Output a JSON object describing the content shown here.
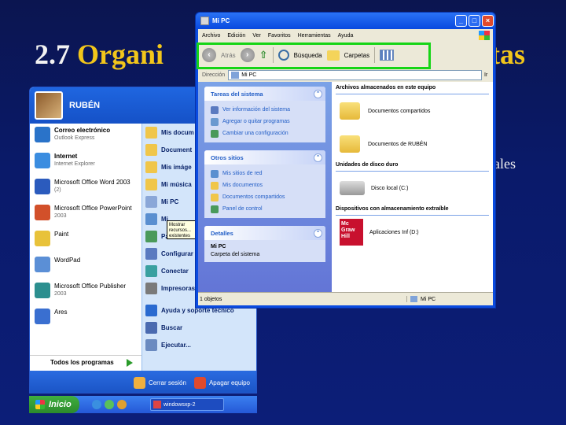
{
  "slide": {
    "title_number": "2.7",
    "title_word": "Organi",
    "title_tail": "tas",
    "side_text": "rales"
  },
  "start_menu": {
    "user": "RUBÉN",
    "left_items": [
      {
        "title": "Correo electrónico",
        "subtitle": "Outlook Express",
        "bold": true,
        "icon": "mail-icon",
        "color": "#2a73c9"
      },
      {
        "title": "Internet",
        "subtitle": "Internet Explorer",
        "bold": true,
        "icon": "internet-explorer-icon",
        "color": "#3b8de0"
      },
      {
        "title": "Microsoft Office Word 2003",
        "subtitle": "(2)",
        "bold": false,
        "icon": "word-icon",
        "color": "#2b5bbd"
      },
      {
        "title": "Microsoft Office PowerPoint",
        "subtitle": "2003",
        "bold": false,
        "icon": "powerpoint-icon",
        "color": "#d2502a"
      },
      {
        "title": "Paint",
        "subtitle": "",
        "bold": false,
        "icon": "paint-icon",
        "color": "#e8c23a"
      },
      {
        "title": "WordPad",
        "subtitle": "",
        "bold": false,
        "icon": "wordpad-icon",
        "color": "#5b8fd6"
      },
      {
        "title": "Microsoft Office Publisher",
        "subtitle": "2003",
        "bold": false,
        "icon": "publisher-icon",
        "color": "#2c8f8f"
      },
      {
        "title": "Ares",
        "subtitle": "",
        "bold": false,
        "icon": "ares-icon",
        "color": "#3a6fd0"
      }
    ],
    "all_programs": "Todos los programas",
    "right_items": [
      {
        "label": "Mis docum",
        "icon": "my-documents-icon",
        "color": "#f0c64a"
      },
      {
        "label": "Document",
        "icon": "recent-documents-icon",
        "color": "#f0c64a"
      },
      {
        "label": "Mis imáge",
        "icon": "my-pictures-icon",
        "color": "#f0c64a"
      },
      {
        "label": "Mi música",
        "icon": "my-music-icon",
        "color": "#f0c64a"
      },
      {
        "label": "Mi PC",
        "icon": "my-computer-icon",
        "color": "#8aa7d8"
      },
      {
        "label": "Mi",
        "icon": "my-network-icon",
        "color": "#5a8fd0"
      },
      {
        "label": "Panel de co",
        "icon": "control-panel-icon",
        "color": "#4a9a5a"
      },
      {
        "label": "Configurar",
        "icon": "set-program-access-icon",
        "color": "#5a7ac0"
      },
      {
        "label": "Conectar",
        "icon": "connect-to-icon",
        "color": "#3aa0a0"
      },
      {
        "label": "Impresoras",
        "icon": "printers-icon",
        "color": "#7a7a7a"
      },
      {
        "label": "Ayuda y soporte técnico",
        "icon": "help-icon",
        "color": "#2a6ad0"
      },
      {
        "label": "Buscar",
        "icon": "search-icon",
        "color": "#4a6ab0"
      },
      {
        "label": "Ejecutar...",
        "icon": "run-icon",
        "color": "#6a8ac0"
      }
    ],
    "tooltip": "Mostrar recursos... existentes",
    "logoff": "Cerrar sesión",
    "shutdown": "Apagar equipo"
  },
  "taskbar": {
    "start": "Inicio",
    "task_label": "windowsxp-2"
  },
  "explorer": {
    "title": "Mi PC",
    "menu": [
      "Archivo",
      "Edición",
      "Ver",
      "Favoritos",
      "Herramientas",
      "Ayuda"
    ],
    "toolbar": {
      "back": "Atrás",
      "search": "Búsqueda",
      "folders": "Carpetas"
    },
    "address_label": "Dirección",
    "address_value": "Mi PC",
    "go": "Ir",
    "panels": {
      "system_tasks": {
        "title": "Tareas del sistema",
        "items": [
          {
            "label": "Ver información del sistema",
            "icon": "system-info-icon",
            "color": "#5a7ac0"
          },
          {
            "label": "Agregar o quitar programas",
            "icon": "add-remove-programs-icon",
            "color": "#6a9ad0"
          },
          {
            "label": "Cambiar una configuración",
            "icon": "change-setting-icon",
            "color": "#4a9a5a"
          }
        ]
      },
      "other_places": {
        "title": "Otros sitios",
        "items": [
          {
            "label": "Mis sitios de red",
            "icon": "network-places-icon",
            "color": "#5a8fd0"
          },
          {
            "label": "Mis documentos",
            "icon": "my-documents-icon",
            "color": "#f0c64a"
          },
          {
            "label": "Documentos compartidos",
            "icon": "shared-documents-icon",
            "color": "#f0c64a"
          },
          {
            "label": "Panel de control",
            "icon": "control-panel-icon",
            "color": "#4a9a5a"
          }
        ]
      },
      "details": {
        "title": "Detalles",
        "name": "Mi PC",
        "desc": "Carpeta del sistema"
      }
    },
    "content": {
      "stored_header": "Archivos almacenados en este equipo",
      "stored": [
        "Documentos compartidos",
        "Documentos de RUBÉN"
      ],
      "hdd_header": "Unidades de disco duro",
      "hdd": [
        "Disco local (C:)"
      ],
      "removable_header": "Dispositivos con almacenamiento extraíble",
      "removable": [
        "Aplicaciones Inf (D:)"
      ],
      "removable_logo": "Mc Graw Hill"
    },
    "status_left": "1 objetos",
    "status_right": "Mi PC"
  }
}
